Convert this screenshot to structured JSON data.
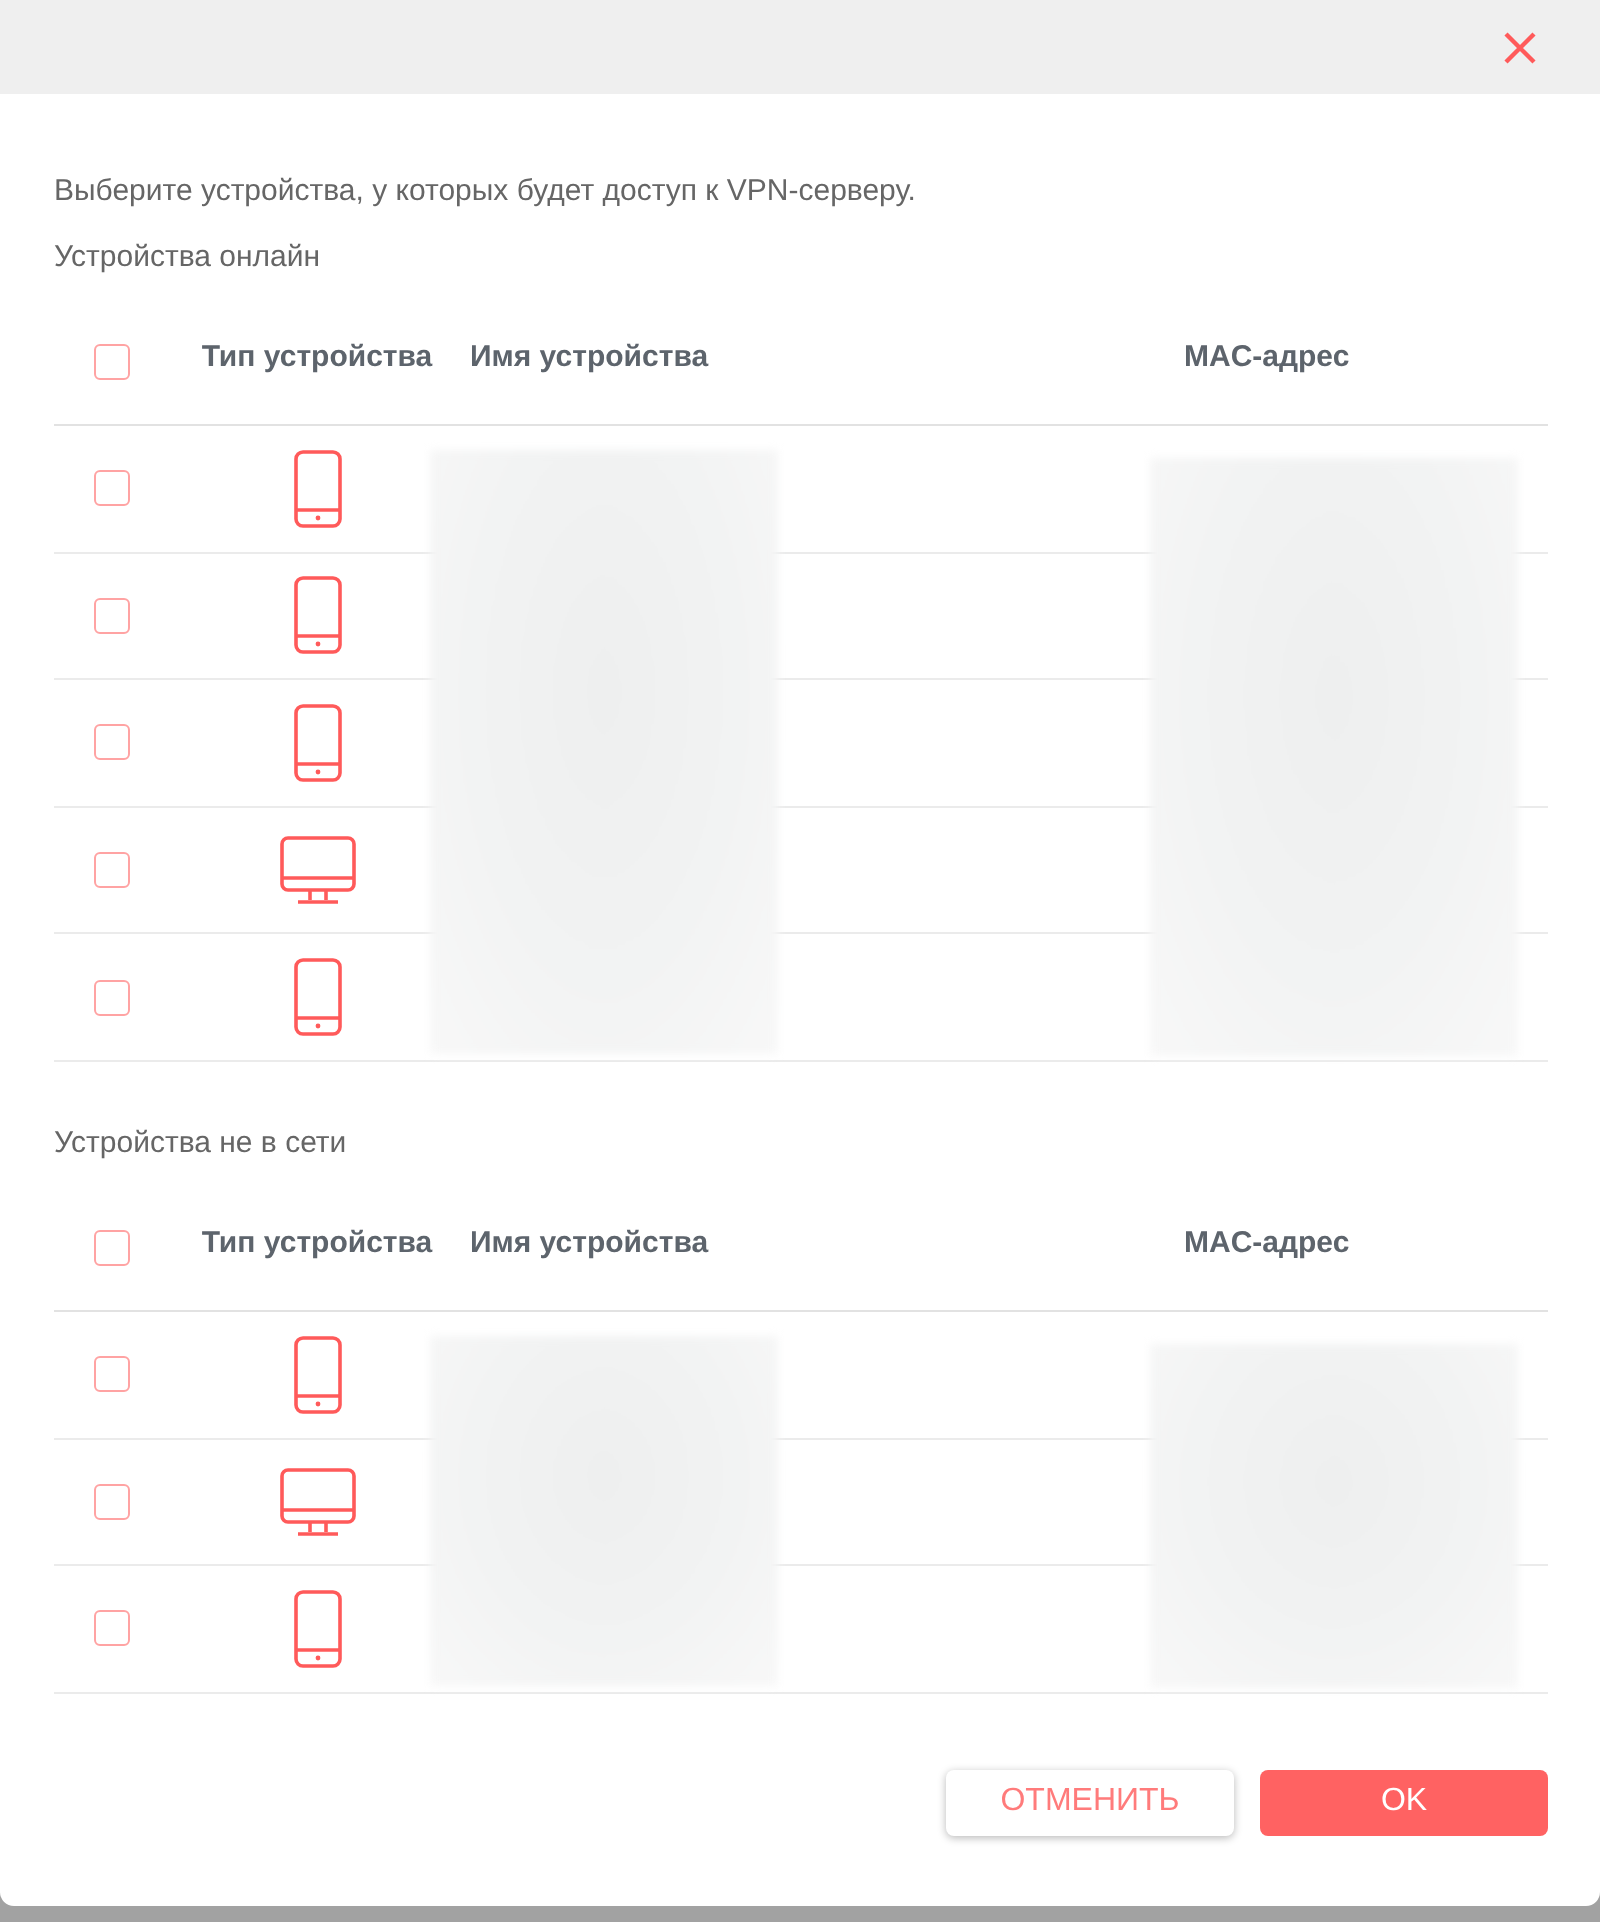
{
  "dialog": {
    "description": "Выберите устройства, у которых будет доступ к VPN-серверу.",
    "sections": [
      {
        "title": "Устройства онлайн",
        "all_checked": false,
        "redacted": true,
        "columns": [
          "Тип устройства",
          "Имя устройства",
          "MAC-адрес"
        ],
        "rows": [
          {
            "kind": "phone",
            "checked": false
          },
          {
            "kind": "phone",
            "checked": false
          },
          {
            "kind": "phone",
            "checked": false
          },
          {
            "kind": "monitor",
            "checked": false
          },
          {
            "kind": "phone",
            "checked": false
          }
        ]
      },
      {
        "title": "Устройства не в сети",
        "all_checked": false,
        "redacted": true,
        "columns": [
          "Тип устройства",
          "Имя устройства",
          "MAC-адрес"
        ],
        "rows": [
          {
            "kind": "phone",
            "checked": false
          },
          {
            "kind": "monitor",
            "checked": false
          },
          {
            "kind": "phone",
            "checked": false
          }
        ]
      }
    ],
    "buttons": [
      {
        "label": "ОТМЕНИТЬ",
        "kind": "cancel"
      },
      {
        "label": "OK",
        "kind": "confirm"
      }
    ]
  }
}
